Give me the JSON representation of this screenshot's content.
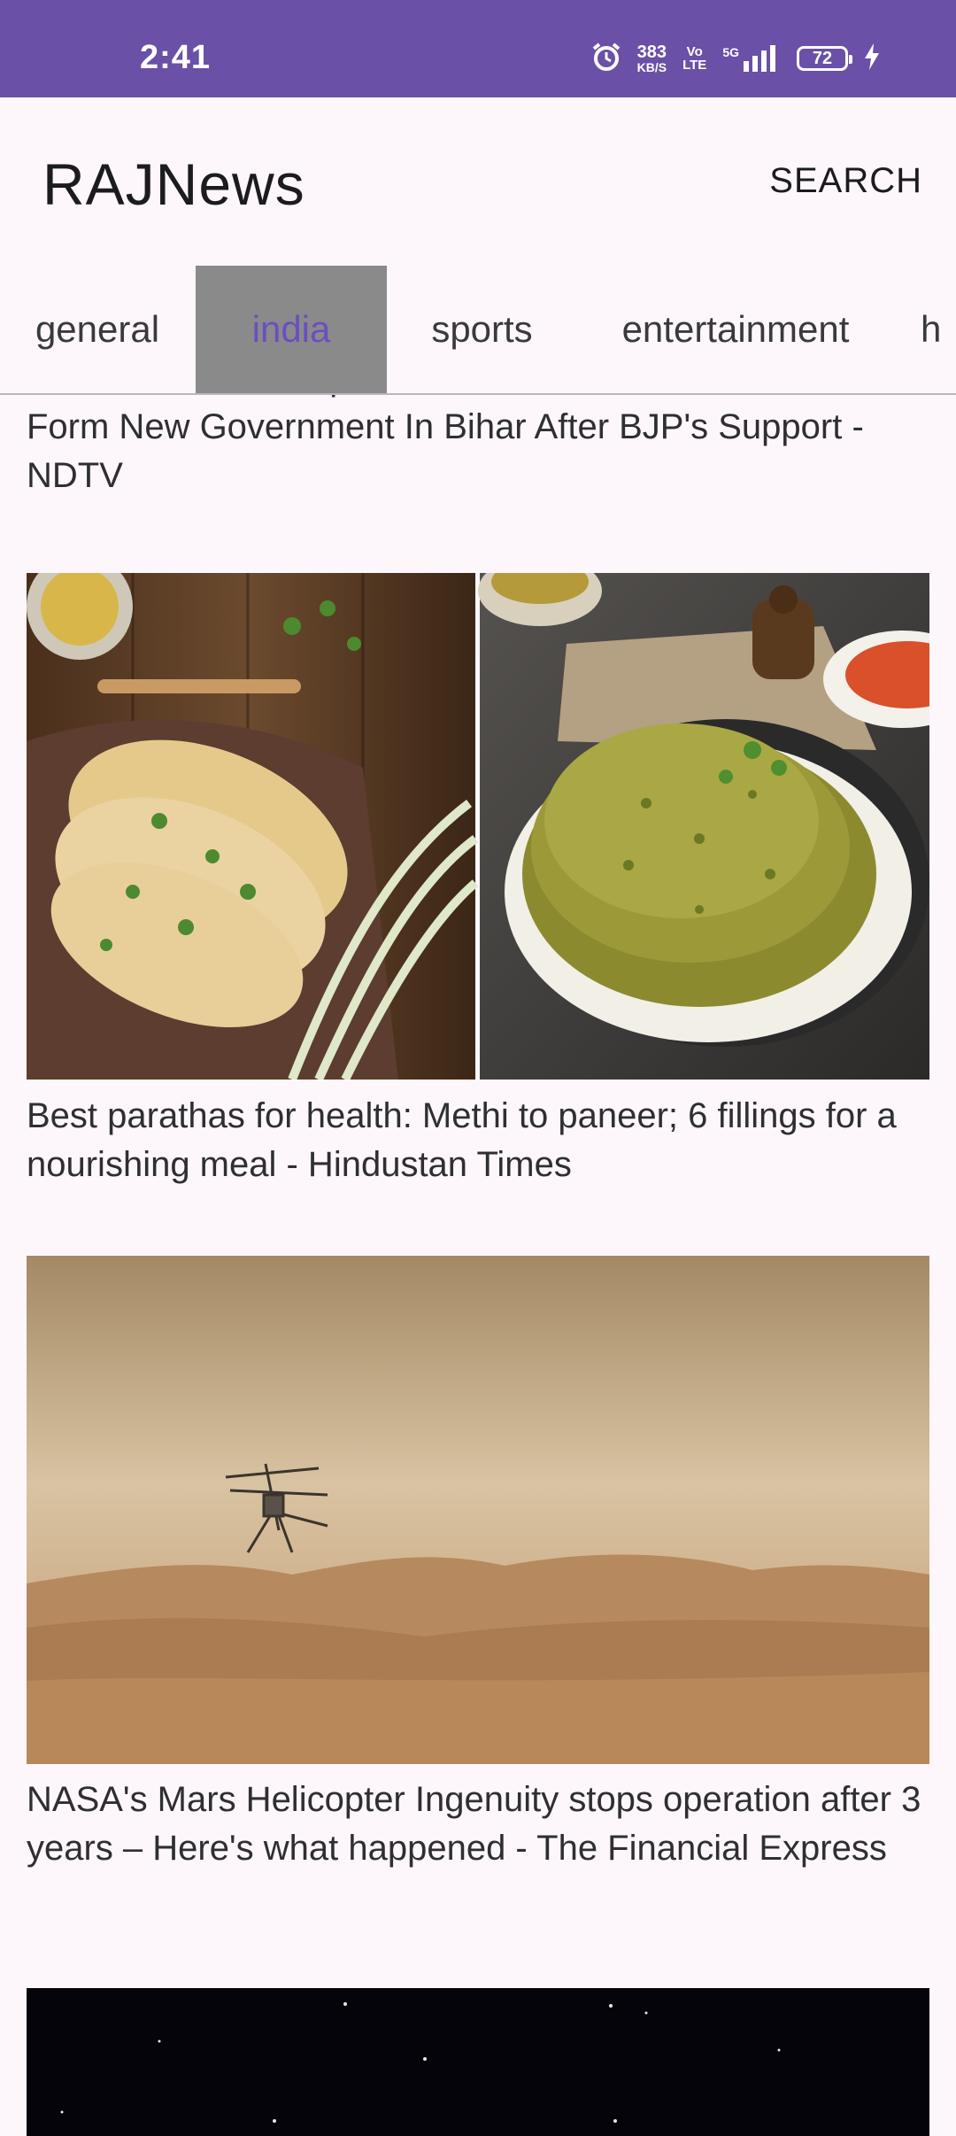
{
  "status_bar": {
    "time": "2:41",
    "net_speed_value": "383",
    "net_speed_unit": "KB/S",
    "volte_top": "Vo",
    "volte_bottom": "LTE",
    "network": "5G",
    "battery": "72"
  },
  "app_bar": {
    "title": "RAJNews",
    "search_label": "SEARCH"
  },
  "tabs": [
    {
      "label": "general",
      "active": false
    },
    {
      "label": "india",
      "active": true
    },
    {
      "label": "sports",
      "active": false
    },
    {
      "label": "entertainment",
      "active": false
    },
    {
      "label": "h",
      "active": false
    }
  ],
  "articles": [
    {
      "headline": "Bihar Crisis LIVE Updates: Nitish Kumar Stakes Claim To Form New Government In Bihar After BJP's Support - NDTV",
      "image": "none"
    },
    {
      "headline": "Best parathas for health: Methi to paneer; 6 fillings for a nourishing meal - Hindustan Times",
      "image": "parathas-photo"
    },
    {
      "headline": "NASA's Mars Helicopter Ingenuity stops operation after 3 years – Here's what happened - The Financial Express",
      "image": "mars-helicopter-photo"
    },
    {
      "headline": "",
      "image": "dark-night-photo"
    }
  ],
  "colors": {
    "status_bar": "#6a50a7",
    "background": "#fdf7fc",
    "active_tab_bg": "#8a8a8a",
    "active_tab_text": "#6b4fc0"
  }
}
